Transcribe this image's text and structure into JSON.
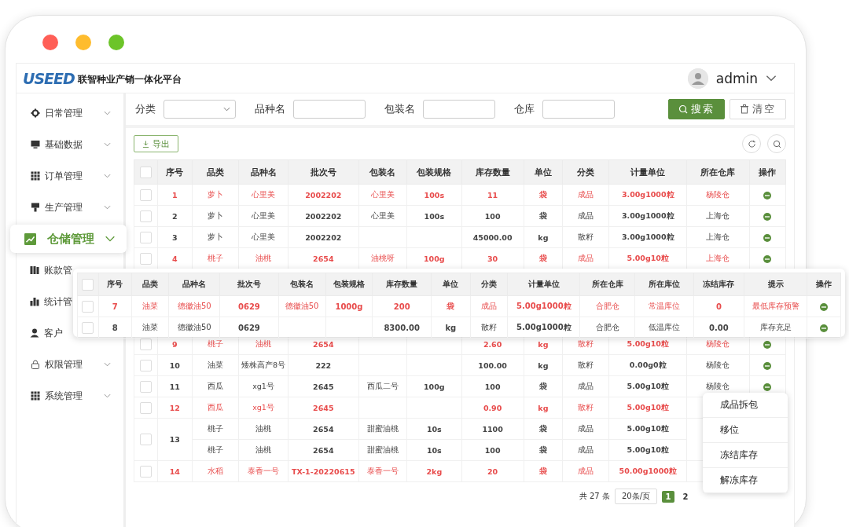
{
  "header": {
    "logo": "USEED",
    "title": "联智种业产销一体化平台",
    "user": "admin"
  },
  "sidebar": {
    "items": [
      {
        "label": "日常管理",
        "kind": "gear",
        "expandable": true,
        "selected": false
      },
      {
        "label": "基础数据",
        "kind": "monitor",
        "expandable": true,
        "selected": false
      },
      {
        "label": "订单管理",
        "kind": "grid",
        "expandable": true,
        "selected": false
      },
      {
        "label": "生产管理",
        "kind": "pin",
        "expandable": true,
        "selected": false
      },
      {
        "label": "仓储管理",
        "kind": "chart",
        "expandable": true,
        "selected": true
      },
      {
        "label": "账款管",
        "kind": "book",
        "expandable": false,
        "selected": false
      },
      {
        "label": "统计管",
        "kind": "bars",
        "expandable": false,
        "selected": false
      },
      {
        "label": "客户",
        "kind": "person",
        "expandable": false,
        "selected": false
      },
      {
        "label": "权限管理",
        "kind": "lock",
        "expandable": true,
        "selected": false
      },
      {
        "label": "系统管理",
        "kind": "grid",
        "expandable": true,
        "selected": false
      }
    ]
  },
  "filters": [
    {
      "label": "分类",
      "kind": "select"
    },
    {
      "label": "品种名",
      "kind": "input"
    },
    {
      "label": "包装名",
      "kind": "input"
    },
    {
      "label": "仓库",
      "kind": "input"
    }
  ],
  "search_button": "搜索",
  "clear_button": "清空",
  "export_button": "导出",
  "table": {
    "all_checked": false,
    "columns": [
      "序号",
      "品类",
      "品种名",
      "批次号",
      "包装名",
      "包装规格",
      "库存数量",
      "单位",
      "分类",
      "计量单位",
      "所在仓库",
      "操作"
    ],
    "rows": [
      {
        "no": "1",
        "alert": true,
        "checked": false,
        "action": true,
        "warehouse": "杨陵仓",
        "lines": [
          {
            "category": "萝卜",
            "variety": "心里美",
            "batch": "2002202",
            "package": "心里美",
            "spec": "100s",
            "stock": "11",
            "unit": "袋",
            "type": "成品",
            "measure": "3.00g1000粒"
          }
        ]
      },
      {
        "no": "2",
        "alert": false,
        "checked": false,
        "action": true,
        "warehouse": "上海仓",
        "lines": [
          {
            "category": "萝卜",
            "variety": "心里美",
            "batch": "2002202",
            "package": "心里美",
            "spec": "100s",
            "stock": "100",
            "unit": "袋",
            "type": "成品",
            "measure": "3.00g1000粒"
          }
        ]
      },
      {
        "no": "3",
        "alert": false,
        "checked": false,
        "action": true,
        "warehouse": "上海仓",
        "lines": [
          {
            "category": "萝卜",
            "variety": "心里美",
            "batch": "2002202",
            "stock": "45000.00",
            "unit": "kg",
            "type": "散籽",
            "measure": "3.00g1000粒"
          }
        ]
      },
      {
        "no": "4",
        "alert": true,
        "checked": false,
        "action": true,
        "warehouse": "上海仓",
        "lines": [
          {
            "category": "桃子",
            "variety": "油桃",
            "batch": "2654",
            "package": "油桃呀",
            "spec": "100g",
            "stock": "30",
            "unit": "袋",
            "type": "成品",
            "measure": "5.00g10粒"
          }
        ]
      },
      {
        "no": "9",
        "alert": true,
        "checked": false,
        "action": true,
        "warehouse": "杨陵仓",
        "lines": [
          {
            "category": "桃子",
            "variety": "油桃",
            "batch": "2654",
            "stock": "2.60",
            "unit": "kg",
            "type": "散籽",
            "measure": "5.00g10粒"
          }
        ]
      },
      {
        "no": "10",
        "alert": false,
        "checked": false,
        "action": true,
        "warehouse": "杨陵仓",
        "lines": [
          {
            "category": "油菜",
            "variety": "矮株高产8号",
            "batch": "222",
            "stock": "100.00",
            "unit": "kg",
            "type": "散籽",
            "measure": "0.00g0粒"
          }
        ]
      },
      {
        "no": "11",
        "alert": false,
        "checked": false,
        "action": true,
        "warehouse": "杨陵仓",
        "lines": [
          {
            "category": "西瓜",
            "variety": "xg1号",
            "batch": "2645",
            "package": "西瓜二号",
            "spec": "100g",
            "stock": "100",
            "unit": "袋",
            "type": "成品",
            "measure": "5.00g10粒"
          }
        ]
      },
      {
        "no": "12",
        "alert": true,
        "checked": false,
        "lines": [
          {
            "category": "西瓜",
            "variety": "xg1号",
            "batch": "2645",
            "stock": "0.90",
            "unit": "kg",
            "type": "散籽",
            "measure": "5.00g10粒"
          }
        ]
      },
      {
        "no": "13",
        "alert": false,
        "checked": false,
        "lines": [
          {
            "category": "桃子",
            "variety": "油桃",
            "batch": "2654",
            "package": "甜蜜油桃",
            "spec": "10s",
            "stock": "1100",
            "unit": "袋",
            "type": "成品",
            "measure": "5.00g10粒"
          },
          {
            "category": "桃子",
            "variety": "油桃",
            "batch": "2654",
            "package": "甜蜜油桃",
            "spec": "10s",
            "stock": "100",
            "unit": "袋",
            "type": "成品",
            "measure": "5.00g10粒"
          }
        ]
      },
      {
        "no": "14",
        "alert": true,
        "checked": false,
        "lines": [
          {
            "category": "水稻",
            "variety": "泰香一号",
            "batch": "TX-1-20220615",
            "package": "泰香一号",
            "spec": "2kg",
            "stock": "20",
            "unit": "袋",
            "type": "成品",
            "measure": "50.00g1000粒"
          }
        ]
      }
    ]
  },
  "zoom_table": {
    "all_checked": false,
    "columns": [
      "序号",
      "品类",
      "品种名",
      "批次号",
      "包装名",
      "包装规格",
      "库存数量",
      "单位",
      "分类",
      "计量单位",
      "所在仓库",
      "所在库位",
      "冻结库存",
      "提示",
      "操作"
    ],
    "rows": [
      {
        "no": "7",
        "alert": true,
        "checked": false,
        "action": true,
        "category": "油菜",
        "variety": "德徽油50",
        "batch": "0629",
        "package": "德徽油50",
        "spec": "1000g",
        "stock": "200",
        "unit": "袋",
        "type": "成品",
        "measure": "5.00g1000粒",
        "warehouse": "合肥仓",
        "location": "常温库位",
        "frozen": "0",
        "hint": "最低库存预警"
      },
      {
        "no": "8",
        "alert": false,
        "checked": false,
        "action": true,
        "category": "油菜",
        "variety": "德徽油50",
        "batch": "0629",
        "stock": "8300.00",
        "unit": "kg",
        "type": "散籽",
        "measure": "5.00g1000粒",
        "warehouse": "合肥仓",
        "location": "低温库位",
        "frozen": "0.00",
        "hint": "库存充足"
      }
    ]
  },
  "context_menu": [
    "成品拆包",
    "移位",
    "冻结库存",
    "解冻库存"
  ],
  "pagination": {
    "total": "共 27 条",
    "page_size": "20条/页",
    "pages": [
      {
        "label": "1",
        "selected": true
      },
      {
        "label": "2",
        "selected": false
      }
    ]
  }
}
